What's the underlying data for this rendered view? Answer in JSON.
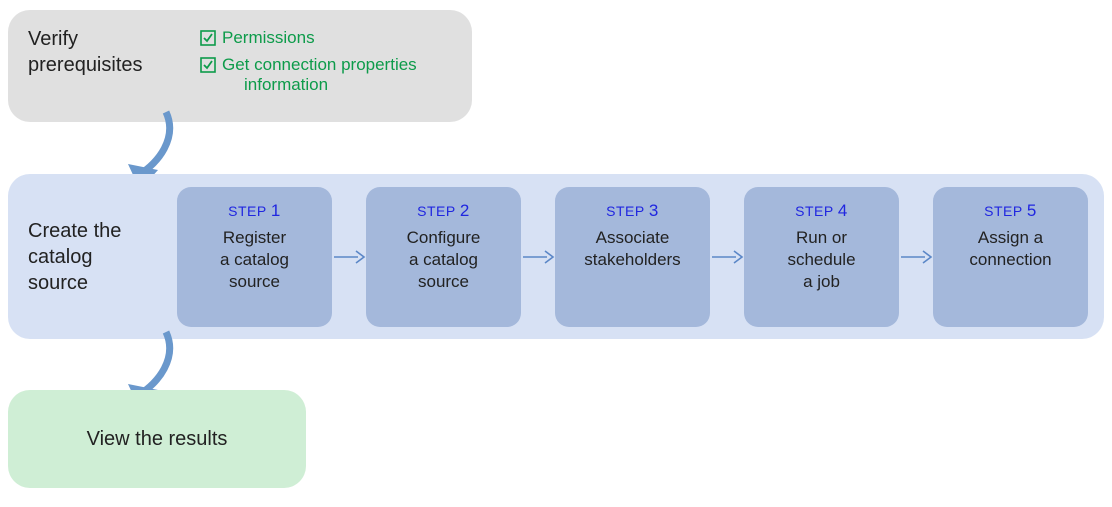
{
  "prereq": {
    "title_line1": "Verify",
    "title_line2": "prerequisites",
    "items": [
      {
        "label": "Permissions"
      },
      {
        "label_line1": "Get connection properties",
        "label_line2": "information"
      }
    ]
  },
  "create": {
    "title_line1": "Create the",
    "title_line2": "catalog",
    "title_line3": "source",
    "steps": [
      {
        "step_prefix": "STEP",
        "step_num": "1",
        "desc_line1": "Register",
        "desc_line2": "a catalog",
        "desc_line3": "source"
      },
      {
        "step_prefix": "STEP",
        "step_num": "2",
        "desc_line1": "Configure",
        "desc_line2": "a catalog",
        "desc_line3": "source"
      },
      {
        "step_prefix": "STEP",
        "step_num": "3",
        "desc_line1": "Associate",
        "desc_line2": "stakeholders",
        "desc_line3": ""
      },
      {
        "step_prefix": "STEP",
        "step_num": "4",
        "desc_line1": "Run or",
        "desc_line2": "schedule",
        "desc_line3": "a job"
      },
      {
        "step_prefix": "STEP",
        "step_num": "5",
        "desc_line1": "Assign a",
        "desc_line2": "connection",
        "desc_line3": ""
      }
    ]
  },
  "results": {
    "title": "View the results"
  },
  "colors": {
    "check_green": "#0d9b4a",
    "step_blue": "#2026e0",
    "arrow_blue": "#5b87c7",
    "curve_arrow": "#6a98cc"
  }
}
